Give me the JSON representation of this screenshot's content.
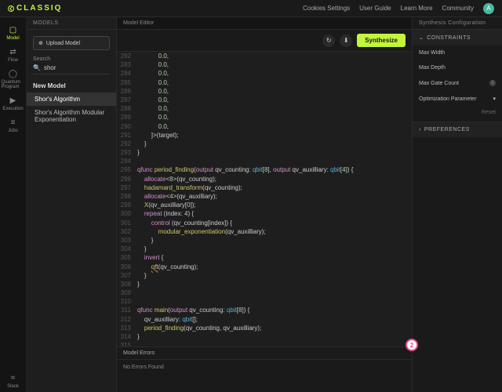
{
  "brand": "CLASSIQ",
  "top_links": [
    "Cookies Settings",
    "User Guide",
    "Learn More",
    "Community"
  ],
  "avatar_initial": "A",
  "leftnav": [
    {
      "icon": "▢",
      "label": "Model",
      "active": true
    },
    {
      "icon": "⇄",
      "label": "Flow"
    },
    {
      "icon": "◯",
      "label": "Quantum Program"
    },
    {
      "icon": "▶",
      "label": "Execution"
    },
    {
      "icon": "≡",
      "label": "Jobs"
    }
  ],
  "leftnav_bottom": {
    "icon": "⌗",
    "label": "Slack"
  },
  "models": {
    "header": "MODELS",
    "upload": "Upload Model",
    "search_label": "Search",
    "search_value": "shor",
    "section": "New Model",
    "items": [
      {
        "label": "Shor's Algorithm",
        "active": true
      },
      {
        "label": "Shor's Algorithm Modular Exponentiation",
        "active": false
      }
    ]
  },
  "editor": {
    "header": "Model Editor",
    "synthesize": "Synthesize",
    "code": [
      {
        "n": 282,
        "t": "            0.0,"
      },
      {
        "n": 283,
        "t": "            0.0,"
      },
      {
        "n": 284,
        "t": "            0.0,"
      },
      {
        "n": 285,
        "t": "            0.0,"
      },
      {
        "n": 286,
        "t": "            0.0,"
      },
      {
        "n": 287,
        "t": "            0.0,"
      },
      {
        "n": 288,
        "t": "            0.0,"
      },
      {
        "n": 289,
        "t": "            0.0,"
      },
      {
        "n": 290,
        "t": "            0.0,"
      },
      {
        "n": 291,
        "t": "        ]>(target);"
      },
      {
        "n": 292,
        "t": "    }"
      },
      {
        "n": 293,
        "t": "}"
      },
      {
        "n": 294,
        "t": ""
      },
      {
        "n": 295,
        "t": "qfunc period_finding(output qv_counting: qbit[8], output qv_auxilliary: qbit[4]) {",
        "hl": true
      },
      {
        "n": 296,
        "t": "    allocate<8>(qv_counting);"
      },
      {
        "n": 297,
        "t": "    hadamard_transform(qv_counting);"
      },
      {
        "n": 298,
        "t": "    allocate<4>(qv_auxilliary);"
      },
      {
        "n": 299,
        "t": "    X(qv_auxilliary[0]);"
      },
      {
        "n": 300,
        "t": "    repeat (index: 4) {"
      },
      {
        "n": 301,
        "t": "        control (qv_counting[index]) {"
      },
      {
        "n": 302,
        "t": "            modular_exponentiation<index>(qv_auxilliary);"
      },
      {
        "n": 303,
        "t": "        }"
      },
      {
        "n": 304,
        "t": "    }"
      },
      {
        "n": 305,
        "t": "    invert {"
      },
      {
        "n": 306,
        "t": "        qft(qv_counting);",
        "warn": true
      },
      {
        "n": 307,
        "t": "    }"
      },
      {
        "n": 308,
        "t": "}"
      },
      {
        "n": 309,
        "t": ""
      },
      {
        "n": 310,
        "t": ""
      },
      {
        "n": 311,
        "t": "qfunc main(output qv_counting: qbit[8]) {",
        "hl": true
      },
      {
        "n": 312,
        "t": "    qv_auxilliary: qbit[];"
      },
      {
        "n": 313,
        "t": "    period_finding(qv_counting, qv_auxilliary);"
      },
      {
        "n": 314,
        "t": "}"
      },
      {
        "n": 315,
        "t": ""
      }
    ],
    "errors_header": "Model Errors",
    "errors_body": "No Errors Found"
  },
  "config": {
    "header": "Synthesis Configuration",
    "constraints": "CONSTRAINTS",
    "fields": [
      "Max Width",
      "Max Depth",
      "Max Gate Count",
      "Optimization Parameter"
    ],
    "reset": "Reset",
    "preferences": "PREFERENCES"
  },
  "fab": "2"
}
